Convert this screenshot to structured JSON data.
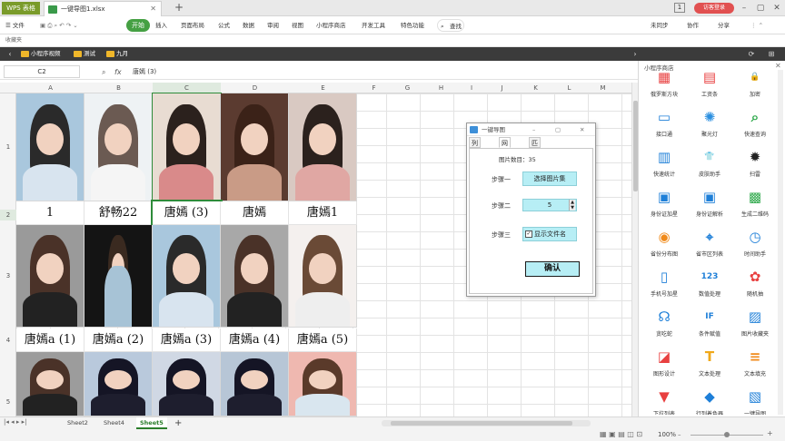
{
  "titlebar": {
    "app_name": "WPS 表格",
    "doc_tab": "一键导图1.xlsx",
    "login": "访客登录",
    "page_badge": "1"
  },
  "menubar": {
    "file": "文件",
    "start": "开始",
    "items": [
      "插入",
      "页面布局",
      "公式",
      "数据",
      "审阅",
      "视图",
      "小程序商店",
      "开发工具",
      "特色功能"
    ],
    "search": "查找",
    "right": [
      "未同步",
      "协作",
      "分享"
    ]
  },
  "favbar": {
    "label": "收藏夹"
  },
  "navbar": {
    "items": [
      "小程序视频",
      "测试",
      "九月"
    ]
  },
  "formula": {
    "namebox": "C2",
    "fx": "fx",
    "value": "唐嫣 (3)"
  },
  "columns": [
    "A",
    "B",
    "C",
    "D",
    "E",
    "F",
    "G",
    "H",
    "I",
    "J",
    "K",
    "L",
    "M"
  ],
  "rows": [
    "1",
    "2",
    "3",
    "4",
    "5"
  ],
  "captions_row2": [
    "1",
    "舒畅22",
    "唐嫣 (3)",
    "唐嫣",
    "唐嫣1"
  ],
  "captions_row4": [
    "唐嫣a (1)",
    "唐嫣a (2)",
    "唐嫣a (3)",
    "唐嫣a (4)",
    "唐嫣a (5)"
  ],
  "sheets": [
    "Sheet2",
    "Sheet4",
    "Sheet5"
  ],
  "active_sheet": "Sheet5",
  "zoom": "100%",
  "dialog": {
    "title": "一键导图",
    "tabs": [
      "列模式",
      "网模式",
      "匹配模式"
    ],
    "active_tab": "网模式",
    "count_label": "图片数目：35",
    "step1_label": "步骤一",
    "step1_button": "选择图片集",
    "step2_label": "步骤二",
    "step2_value": "5",
    "step3_label": "步骤三",
    "step3_checkbox": "显示文件名",
    "step3_checked": true,
    "confirm": "确认"
  },
  "side_panel": {
    "title": "小程序商店",
    "items": [
      {
        "label": "俄罗斯方块",
        "icon": "tetris-icon",
        "color": "#e84040"
      },
      {
        "label": "工资条",
        "icon": "salary-icon",
        "color": "#e84040"
      },
      {
        "label": "加密",
        "icon": "lock-icon",
        "color": "#2da84a"
      },
      {
        "label": "接口通",
        "icon": "monitor-icon",
        "color": "#1e7fd8"
      },
      {
        "label": "聚光灯",
        "icon": "bulb-icon",
        "color": "#2a8fe0"
      },
      {
        "label": "快速查询",
        "icon": "search-icon",
        "color": "#2da84a"
      },
      {
        "label": "快速统计",
        "icon": "stats-icon",
        "color": "#1e7fd8"
      },
      {
        "label": "皮肤助手",
        "icon": "tshirt-icon",
        "color": "#e85030"
      },
      {
        "label": "扫雷",
        "icon": "mine-icon",
        "color": "#222222"
      },
      {
        "label": "身份证加星",
        "icon": "idcard-icon",
        "color": "#1e7fd8"
      },
      {
        "label": "身份证解析",
        "icon": "idcard-icon",
        "color": "#1e7fd8"
      },
      {
        "label": "生成二维码",
        "icon": "qrcode-icon",
        "color": "#2da84a"
      },
      {
        "label": "省份分布图",
        "icon": "map-icon",
        "color": "#f08a1a"
      },
      {
        "label": "省市区列表",
        "icon": "pin-icon",
        "color": "#1e7fd8"
      },
      {
        "label": "时间助手",
        "icon": "clock-icon",
        "color": "#1e7fd8"
      },
      {
        "label": "手机号加星",
        "icon": "phone-icon",
        "color": "#1e7fd8"
      },
      {
        "label": "数值处理",
        "icon": "number-icon",
        "color": "#1e7fd8"
      },
      {
        "label": "随机抽",
        "icon": "random-icon",
        "color": "#e84040"
      },
      {
        "label": "贪吃蛇",
        "icon": "ghost-icon",
        "color": "#1e7fd8"
      },
      {
        "label": "条件赋值",
        "icon": "if-icon",
        "color": "#1e7fd8"
      },
      {
        "label": "图片收藏夹",
        "icon": "picture-icon",
        "color": "#1e7fd8"
      },
      {
        "label": "图形设计",
        "icon": "shape-icon",
        "color": "#e84040"
      },
      {
        "label": "文本处理",
        "icon": "text-icon",
        "color": "#f0a81a"
      },
      {
        "label": "文本填充",
        "icon": "fill-icon",
        "color": "#f08a1a"
      },
      {
        "label": "下拉列表",
        "icon": "dropdown-icon",
        "color": "#e84040"
      },
      {
        "label": "行列着色器",
        "icon": "paint-icon",
        "color": "#1e7fd8"
      },
      {
        "label": "一键导图",
        "icon": "import-image-icon",
        "color": "#1e7fd8"
      }
    ],
    "glyphs": [
      "▦",
      "▤",
      "🔒",
      "▭",
      "✺",
      "⌕",
      "▥",
      "👕",
      "✹",
      "▣",
      "▣",
      "▩",
      "◉",
      "⌖",
      "◷",
      "▯",
      "123",
      "✿",
      "☊",
      "IF",
      "▨",
      "◪",
      "T",
      "≡",
      "▼",
      "◆",
      "▧"
    ]
  }
}
